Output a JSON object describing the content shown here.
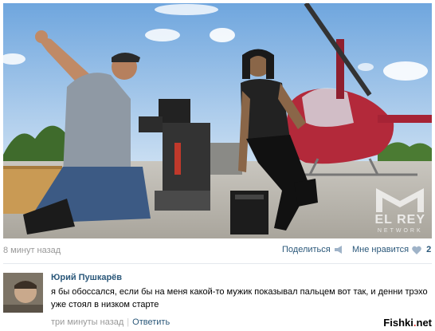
{
  "post": {
    "time": "8 минут назад",
    "share_label": "Поделиться",
    "like_label": "Мне нравится",
    "like_count": "2",
    "watermark_main": "EL REY",
    "watermark_sub": "NETWORK"
  },
  "comment": {
    "author": "Юрий Пушкарёв",
    "text": "я бы обоссался, если бы на меня какой-то мужик показывал пальцем вот так, и денни трэхо уже стоял в низком старте",
    "time": "три минуты назад",
    "reply_label": "Ответить"
  },
  "site": {
    "brand_main": "Fishki",
    "brand_dot": ".",
    "brand_tld": "net"
  },
  "icons": {
    "share": "megaphone-icon",
    "like": "heart-icon"
  },
  "colors": {
    "link": "#2b587a",
    "muted": "#999999",
    "helicopter": "#b3293a",
    "sky": "#8ab7e6"
  }
}
